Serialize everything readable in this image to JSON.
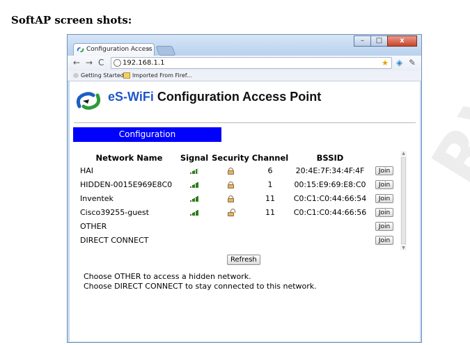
{
  "document": {
    "heading": "SoftAP screen shots:"
  },
  "watermark": {
    "text": "RV"
  },
  "browser": {
    "tab_title": "Configuration Access Poin",
    "address": "192.168.1.1",
    "bookmarks": [
      "Getting Started",
      "Imported From Firef..."
    ],
    "window_buttons": {
      "minimize": "–",
      "maximize": "□",
      "close": "x"
    }
  },
  "page": {
    "title_brand": "eS-WiFi",
    "title_rest": " Configuration Access Point",
    "section_label": "Configuration",
    "table": {
      "headers": [
        "Network Name",
        "Signal",
        "Security",
        "Channel",
        "BSSID"
      ],
      "rows": [
        {
          "name": "HAI",
          "signal_level": 4,
          "secured": true,
          "channel": "6",
          "bssid": "20:4E:7F:34:4F:4F",
          "join_label": "Join"
        },
        {
          "name": "HIDDEN-0015E969E8C0",
          "signal_level": 5,
          "secured": true,
          "channel": "1",
          "bssid": "00:15:E9:69:E8:C0",
          "join_label": "Join"
        },
        {
          "name": "Inventek",
          "signal_level": 5,
          "secured": true,
          "channel": "11",
          "bssid": "C0:C1:C0:44:66:54",
          "join_label": "Join"
        },
        {
          "name": "Cisco39255-guest",
          "signal_level": 5,
          "secured": false,
          "channel": "11",
          "bssid": "C0:C1:C0:44:66:56",
          "join_label": "Join"
        },
        {
          "name": "OTHER",
          "signal_level": 0,
          "secured": null,
          "channel": "",
          "bssid": "",
          "join_label": "Join"
        },
        {
          "name": "DIRECT CONNECT",
          "signal_level": 0,
          "secured": null,
          "channel": "",
          "bssid": "",
          "join_label": "Join"
        }
      ]
    },
    "refresh_label": "Refresh",
    "notes": [
      "Choose OTHER to access a hidden network.",
      "Choose DIRECT CONNECT to stay connected to this network."
    ]
  },
  "colors": {
    "section_bar": "#0000ff",
    "brand": "#1e56c9",
    "signal": "#2e7d1a"
  }
}
